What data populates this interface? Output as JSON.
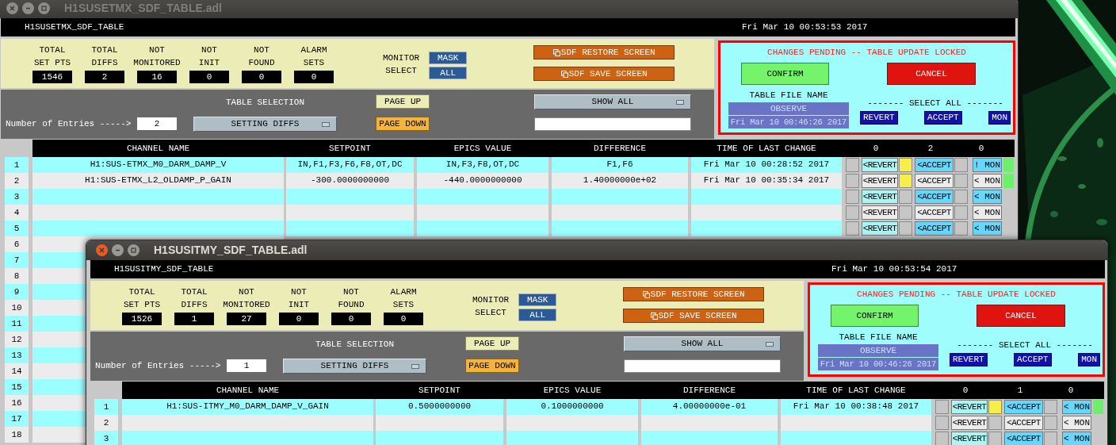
{
  "windows": [
    {
      "title": "H1SUSETMX_SDF_TABLE.adl",
      "focused": false,
      "screen_name": "H1SUSETMX_SDF_TABLE",
      "datetime": "Fri Mar 10 00:53:53 2017",
      "stats": [
        {
          "label": [
            "TOTAL",
            "SET PTS"
          ],
          "value": "1546"
        },
        {
          "label": [
            "TOTAL",
            "DIFFS"
          ],
          "value": "2"
        },
        {
          "label": [
            "NOT",
            "MONITORED"
          ],
          "value": "16"
        },
        {
          "label": [
            "NOT",
            "INIT"
          ],
          "value": "0"
        },
        {
          "label": [
            "NOT",
            "FOUND"
          ],
          "value": "0"
        },
        {
          "label": [
            "ALARM",
            "SETS"
          ],
          "value": "0"
        }
      ],
      "monitor_select": {
        "label": [
          "MONITOR",
          "SELECT"
        ],
        "options": [
          "MASK",
          "ALL"
        ]
      },
      "restore_button": "SDF RESTORE SCREEN",
      "save_button": "SDF SAVE SCREEN",
      "entries_label": "Number of Entries ----->",
      "entries_value": "2",
      "table_selection": {
        "label": "TABLE SELECTION",
        "value": "SETTING DIFFS"
      },
      "page_up": "PAGE UP",
      "page_down": "PAGE DOWN",
      "show_menu": "SHOW ALL",
      "pending": {
        "message": "CHANGES PENDING -- TABLE UPDATE LOCKED",
        "confirm": "CONFIRM",
        "cancel": "CANCEL",
        "file_label": "TABLE FILE NAME",
        "file_name": "OBSERVE",
        "file_time": "Fri Mar 10 00:46:26 2017",
        "select_all_label": "------- SELECT ALL -------",
        "select_all_buttons": [
          "REVERT",
          "ACCEPT",
          "MON"
        ]
      },
      "columns": [
        "CHANNEL NAME",
        "SETPOINT",
        "EPICS VALUE",
        "DIFFERENCE",
        "TIME OF LAST CHANGE"
      ],
      "counts": [
        "0",
        "2",
        "0"
      ],
      "rows": [
        {
          "number": "1",
          "cells": [
            "H1:SUS-ETMX_M0_DARM_DAMP_V",
            "IN,F1,F3,F6,F8,OT,DC",
            "IN,F3,F8,OT,DC",
            "F1,F6",
            "Fri Mar 10 00:28:52 2017"
          ],
          "revert": false,
          "revert_label": "<REVERT",
          "accept": true,
          "accept_label": "<ACCEPT",
          "monitor": false,
          "mon_label": "! MON",
          "monitored": true
        },
        {
          "number": "2",
          "cells": [
            "H1:SUS-ETMX_L2_OLDAMP_P_GAIN",
            "-300.0000000000",
            "-440.0000000000",
            "1.40000000e+02",
            "Fri Mar 10 00:35:34 2017"
          ],
          "revert": false,
          "revert_label": "<REVERT",
          "accept": true,
          "accept_label": "<ACCEPT",
          "monitor": false,
          "mon_label": "< MON",
          "monitored": true
        },
        {
          "number": "3",
          "revert": false,
          "revert_label": "<REVERT",
          "accept": false,
          "accept_label": "<ACCEPT",
          "monitor": false,
          "mon_label": "< MON",
          "monitored": false
        },
        {
          "number": "4",
          "revert": false,
          "revert_label": "<REVERT",
          "accept": false,
          "accept_label": "<ACCEPT",
          "monitor": false,
          "mon_label": "< MON",
          "monitored": false
        },
        {
          "number": "5",
          "revert": false,
          "revert_label": "<REVERT",
          "accept": false,
          "accept_label": "<ACCEPT",
          "monitor": false,
          "mon_label": "< MON",
          "monitored": false
        },
        {
          "number": "6"
        },
        {
          "number": "7"
        },
        {
          "number": "8"
        },
        {
          "number": "9"
        },
        {
          "number": "10"
        },
        {
          "number": "11"
        },
        {
          "number": "12"
        },
        {
          "number": "13"
        },
        {
          "number": "14"
        },
        {
          "number": "15"
        },
        {
          "number": "16"
        },
        {
          "number": "17"
        },
        {
          "number": "18"
        }
      ]
    },
    {
      "title": "H1SUSITMY_SDF_TABLE.adl",
      "focused": true,
      "screen_name": "H1SUSITMY_SDF_TABLE",
      "datetime": "Fri Mar 10 00:53:54 2017",
      "stats": [
        {
          "label": [
            "TOTAL",
            "SET PTS"
          ],
          "value": "1526"
        },
        {
          "label": [
            "TOTAL",
            "DIFFS"
          ],
          "value": "1"
        },
        {
          "label": [
            "NOT",
            "MONITORED"
          ],
          "value": "27"
        },
        {
          "label": [
            "NOT",
            "INIT"
          ],
          "value": "0"
        },
        {
          "label": [
            "NOT",
            "FOUND"
          ],
          "value": "0"
        },
        {
          "label": [
            "ALARM",
            "SETS"
          ],
          "value": "0"
        }
      ],
      "monitor_select": {
        "label": [
          "MONITOR",
          "SELECT"
        ],
        "options": [
          "MASK",
          "ALL"
        ]
      },
      "restore_button": "SDF RESTORE SCREEN",
      "save_button": "SDF SAVE SCREEN",
      "entries_label": "Number of Entries ----->",
      "entries_value": "1",
      "table_selection": {
        "label": "TABLE SELECTION",
        "value": "SETTING DIFFS"
      },
      "page_up": "PAGE UP",
      "page_down": "PAGE DOWN",
      "show_menu": "SHOW ALL",
      "pending": {
        "message": "CHANGES PENDING -- TABLE UPDATE LOCKED",
        "confirm": "CONFIRM",
        "cancel": "CANCEL",
        "file_label": "TABLE FILE NAME",
        "file_name": "OBSERVE",
        "file_time": "Fri Mar 10 00:46:26 2017",
        "select_all_label": "------- SELECT ALL -------",
        "select_all_buttons": [
          "REVERT",
          "ACCEPT",
          "MON"
        ]
      },
      "columns": [
        "CHANNEL NAME",
        "SETPOINT",
        "EPICS VALUE",
        "DIFFERENCE",
        "TIME OF LAST CHANGE"
      ],
      "counts": [
        "0",
        "1",
        "0"
      ],
      "rows": [
        {
          "number": "1",
          "cells": [
            "H1:SUS-ITMY_M0_DARM_DAMP_V_GAIN",
            "0.5000000000",
            "0.1000000000",
            "4.00000000e-01",
            "Fri Mar 10 00:38:48 2017"
          ],
          "revert": false,
          "revert_label": "<REVERT",
          "accept": true,
          "accept_label": "<ACCEPT",
          "monitor": false,
          "mon_label": "< MON",
          "monitored": true
        },
        {
          "number": "2",
          "revert": false,
          "revert_label": "<REVERT",
          "accept": false,
          "accept_label": "<ACCEPT",
          "monitor": false,
          "mon_label": "< MON",
          "monitored": false
        },
        {
          "number": "3",
          "revert": false,
          "revert_label": "<REVERT",
          "accept": false,
          "accept_label": "<ACCEPT",
          "monitor": false,
          "mon_label": "< MON",
          "monitored": false
        }
      ]
    }
  ]
}
